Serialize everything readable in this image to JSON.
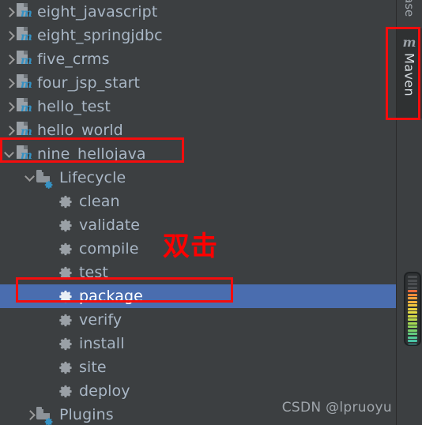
{
  "window": {
    "title": "Maven Tool Window",
    "background_color": "#3c3f41",
    "selection_color": "#4a6daf",
    "text_color": "#a9b7c6",
    "accent_color": "#3592c4",
    "annotation_color": "#ff0000"
  },
  "tree": {
    "items": [
      {
        "label": "eight_javascript",
        "icon": "maven-module-icon",
        "indent": 0,
        "expander": "collapsed",
        "selected": false
      },
      {
        "label": "eight_springjdbc",
        "icon": "maven-module-icon",
        "indent": 0,
        "expander": "collapsed",
        "selected": false
      },
      {
        "label": "five_crms",
        "icon": "maven-module-icon",
        "indent": 0,
        "expander": "collapsed",
        "selected": false
      },
      {
        "label": "four_jsp_start",
        "icon": "maven-module-icon",
        "indent": 0,
        "expander": "collapsed",
        "selected": false
      },
      {
        "label": "hello_test",
        "icon": "maven-module-icon",
        "indent": 0,
        "expander": "collapsed",
        "selected": false
      },
      {
        "label": "hello_world",
        "icon": "maven-module-icon",
        "indent": 0,
        "expander": "collapsed",
        "selected": false
      },
      {
        "label": "nine_hellojava",
        "icon": "maven-module-icon",
        "indent": 0,
        "expander": "expanded",
        "selected": false
      },
      {
        "label": "Lifecycle",
        "icon": "folder-gear-icon",
        "indent": 1,
        "expander": "expanded",
        "selected": false
      },
      {
        "label": "clean",
        "icon": "gear-icon",
        "indent": 2,
        "expander": "none",
        "selected": false
      },
      {
        "label": "validate",
        "icon": "gear-icon",
        "indent": 2,
        "expander": "none",
        "selected": false
      },
      {
        "label": "compile",
        "icon": "gear-icon",
        "indent": 2,
        "expander": "none",
        "selected": false
      },
      {
        "label": "test",
        "icon": "gear-icon",
        "indent": 2,
        "expander": "none",
        "selected": false
      },
      {
        "label": "package",
        "icon": "gear-icon",
        "indent": 2,
        "expander": "none",
        "selected": true
      },
      {
        "label": "verify",
        "icon": "gear-icon",
        "indent": 2,
        "expander": "none",
        "selected": false
      },
      {
        "label": "install",
        "icon": "gear-icon",
        "indent": 2,
        "expander": "none",
        "selected": false
      },
      {
        "label": "site",
        "icon": "gear-icon",
        "indent": 2,
        "expander": "none",
        "selected": false
      },
      {
        "label": "deploy",
        "icon": "gear-icon",
        "indent": 2,
        "expander": "none",
        "selected": false
      },
      {
        "label": "Plugins",
        "icon": "folder-gear-icon",
        "indent": 1,
        "expander": "collapsed",
        "selected": false
      }
    ]
  },
  "annotations": {
    "double_click_text": "双击",
    "highlight_boxes": [
      {
        "name": "nine-hellojava-highlight",
        "target": "nine_hellojava"
      },
      {
        "name": "package-highlight",
        "target": "package"
      },
      {
        "name": "maven-tab-highlight",
        "target": "Maven"
      }
    ]
  },
  "right_strip": {
    "database_tab_label": "ase",
    "maven_tab_label": "Maven",
    "maven_tab_icon_glyph": "m"
  },
  "spectrum": {
    "name": "error-stripe-spectrum",
    "colors": [
      "#4a4d50",
      "#4a4d50",
      "#4a4d50",
      "#4a4d50",
      "#e86a3a",
      "#f08a3a",
      "#f3a23c",
      "#f2b23e",
      "#efc43f",
      "#ecd341",
      "#e4dd45",
      "#d4dd48",
      "#bcdb4d",
      "#a4d853",
      "#8ed45c",
      "#78d06b",
      "#63cc80",
      "#53c894",
      "#4ac4a6",
      "#46c0b4",
      "#44bcc0",
      "#45b8c6"
    ]
  },
  "watermark": {
    "text": "CSDN @lpruoyu"
  }
}
